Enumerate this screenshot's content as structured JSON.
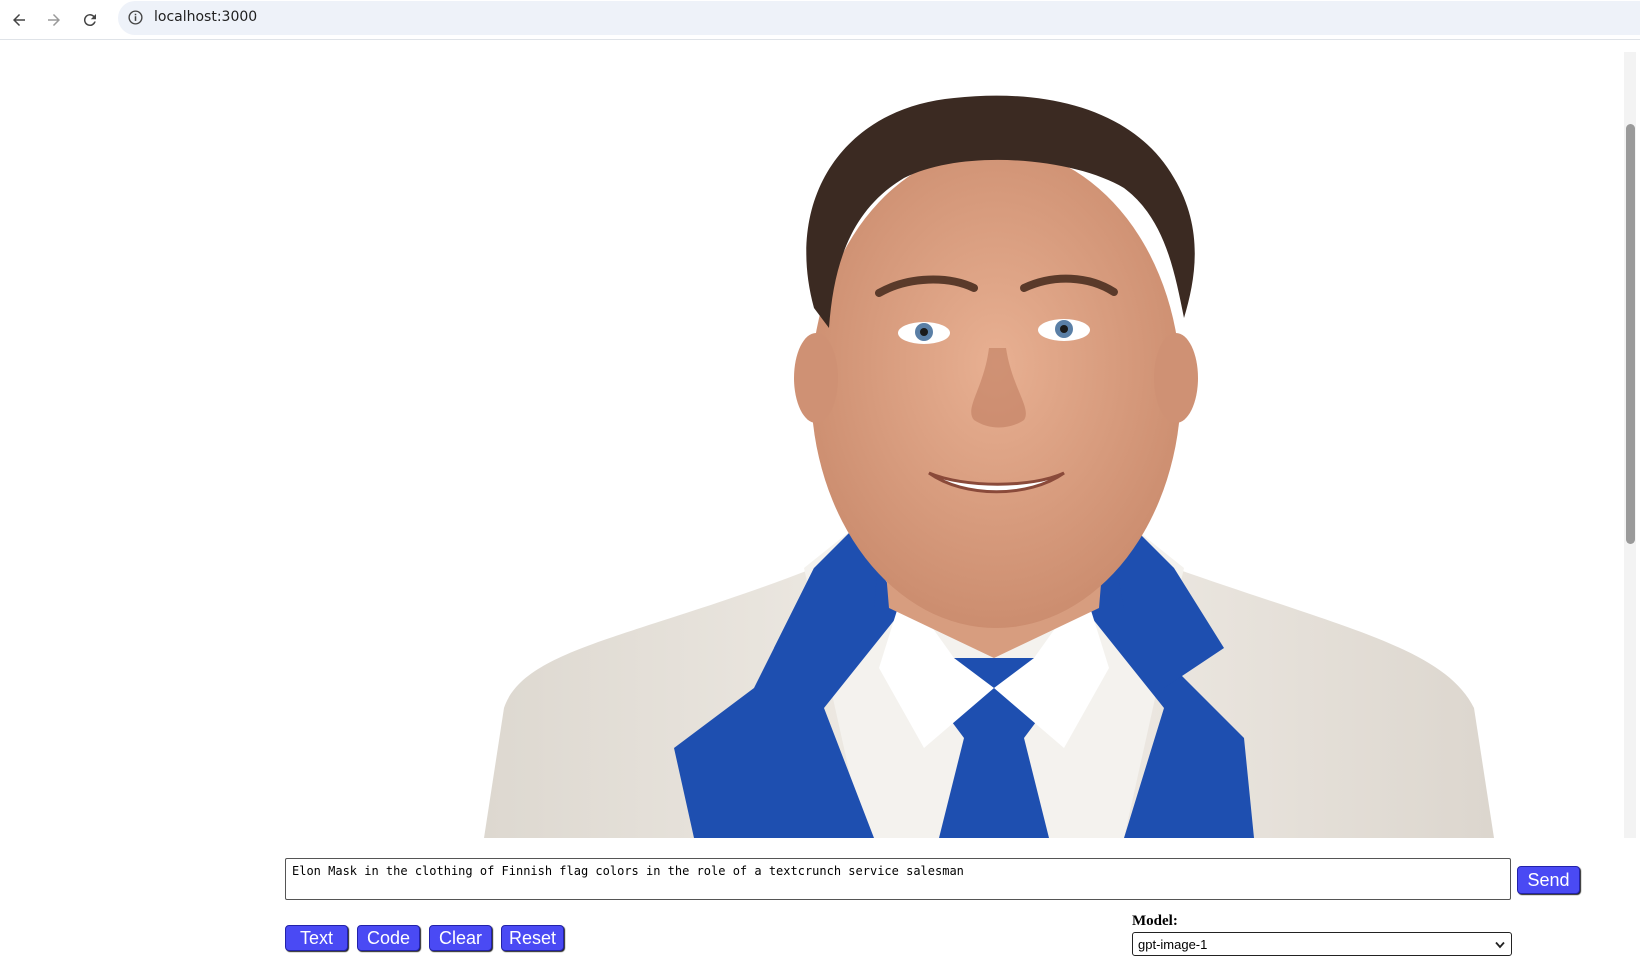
{
  "browser": {
    "url": "localhost:3000",
    "nav_icons": [
      "back-arrow-icon",
      "forward-arrow-icon",
      "reload-icon",
      "info-icon"
    ]
  },
  "image": {
    "alt": "Generated portrait of a man in a white suit with a blue tie and blue lapels",
    "colors": {
      "suit": "#ece8e2",
      "accent_blue": "#1e4fb0"
    }
  },
  "prompt": {
    "value": "Elon Mask in the clothing of Finnish flag colors in the role of a textcrunch service salesman"
  },
  "buttons": {
    "send": "Send",
    "text": "Text",
    "code": "Code",
    "clear": "Clear",
    "reset": "Reset"
  },
  "model": {
    "label": "Model:",
    "selected": "gpt-image-1"
  },
  "theme": {
    "button_bg": "#4a4af4"
  }
}
